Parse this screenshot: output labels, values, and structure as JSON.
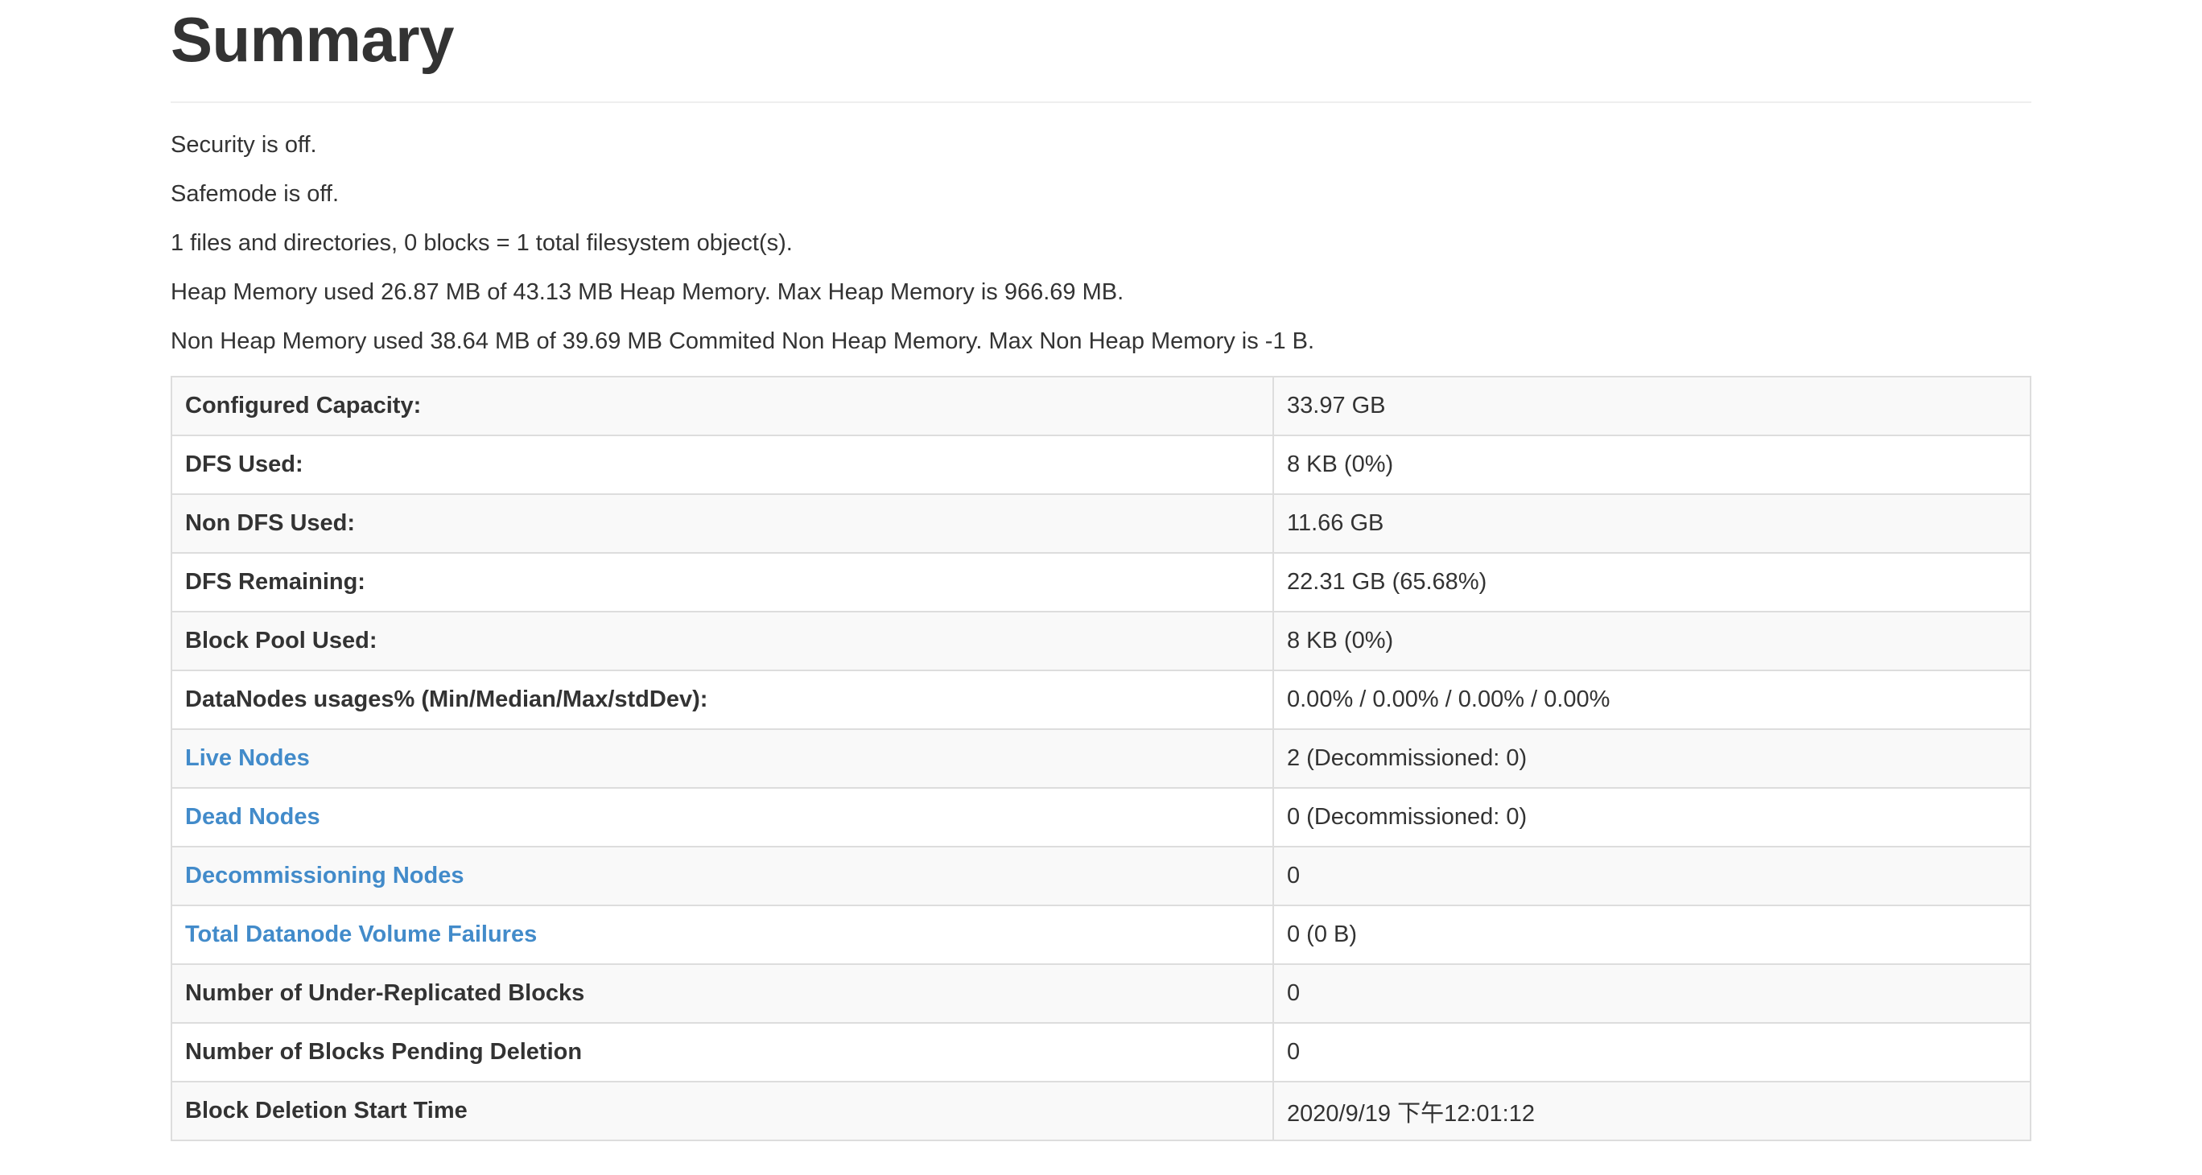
{
  "header": {
    "title": "Summary"
  },
  "status": [
    "Security is off.",
    "Safemode is off.",
    "1 files and directories, 0 blocks = 1 total filesystem object(s).",
    "Heap Memory used 26.87 MB of 43.13 MB Heap Memory. Max Heap Memory is 966.69 MB.",
    "Non Heap Memory used 38.64 MB of 39.69 MB Commited Non Heap Memory. Max Non Heap Memory is -1 B."
  ],
  "table": {
    "rows": [
      {
        "key": "Configured Capacity:",
        "value": "33.97 GB"
      },
      {
        "key": "DFS Used:",
        "value": "8 KB (0%)"
      },
      {
        "key": "Non DFS Used:",
        "value": "11.66 GB"
      },
      {
        "key": "DFS Remaining:",
        "value": "22.31 GB (65.68%)"
      },
      {
        "key": "Block Pool Used:",
        "value": "8 KB (0%)"
      },
      {
        "key": "DataNodes usages% (Min/Median/Max/stdDev):",
        "value": "0.00% / 0.00% / 0.00% / 0.00%"
      },
      {
        "key": "Live Nodes",
        "value": "2 (Decommissioned: 0)"
      },
      {
        "key": "Dead Nodes",
        "value": "0 (Decommissioned: 0)"
      },
      {
        "key": "Decommissioning Nodes",
        "value": "0"
      },
      {
        "key": "Total Datanode Volume Failures",
        "value": "0 (0 B)"
      },
      {
        "key": "Number of Under-Replicated Blocks",
        "value": "0"
      },
      {
        "key": "Number of Blocks Pending Deletion",
        "value": "0"
      },
      {
        "key": "Block Deletion Start Time",
        "value": "2020/9/19 下午12:01:12"
      }
    ]
  },
  "colors": {
    "link": "#428bca",
    "text": "#333333",
    "row_stripe": "#f9f9f9",
    "border": "#dddddd"
  }
}
